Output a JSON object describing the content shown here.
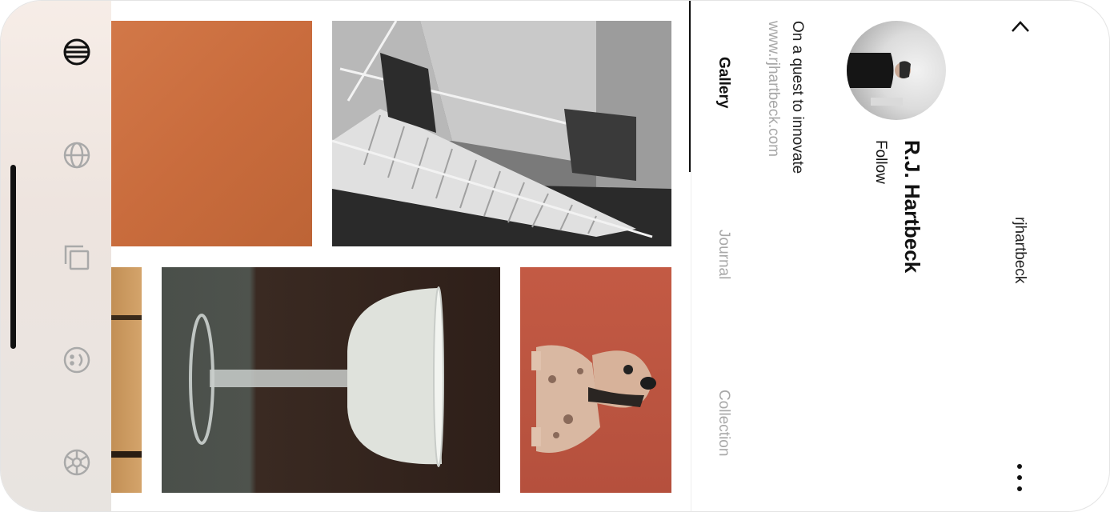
{
  "profile": {
    "username": "rjhartbeck",
    "name": "R.J. Hartbeck",
    "follow_label": "Follow",
    "bio": "On a quest to innovate",
    "website": "www.rjhartbeck.com"
  },
  "tabs": [
    {
      "label": "Gallery",
      "active": true
    },
    {
      "label": "Journal",
      "active": false
    },
    {
      "label": "Collection",
      "active": false
    }
  ],
  "rail_icons": [
    "menu-icon",
    "globe-icon",
    "copy-icon",
    "smiley-icon",
    "settings-icon"
  ],
  "gallery": [
    {
      "name": "orange-wall-photo"
    },
    {
      "name": "concrete-staircase-photo"
    },
    {
      "name": "wood-panel-photo"
    },
    {
      "name": "cocktail-glass-photo"
    },
    {
      "name": "ceramic-dog-photo"
    }
  ],
  "colors": {
    "accent": "#111111",
    "muted": "#a8a8a8",
    "orange": "#c96c3d",
    "terracotta": "#c35a44"
  }
}
